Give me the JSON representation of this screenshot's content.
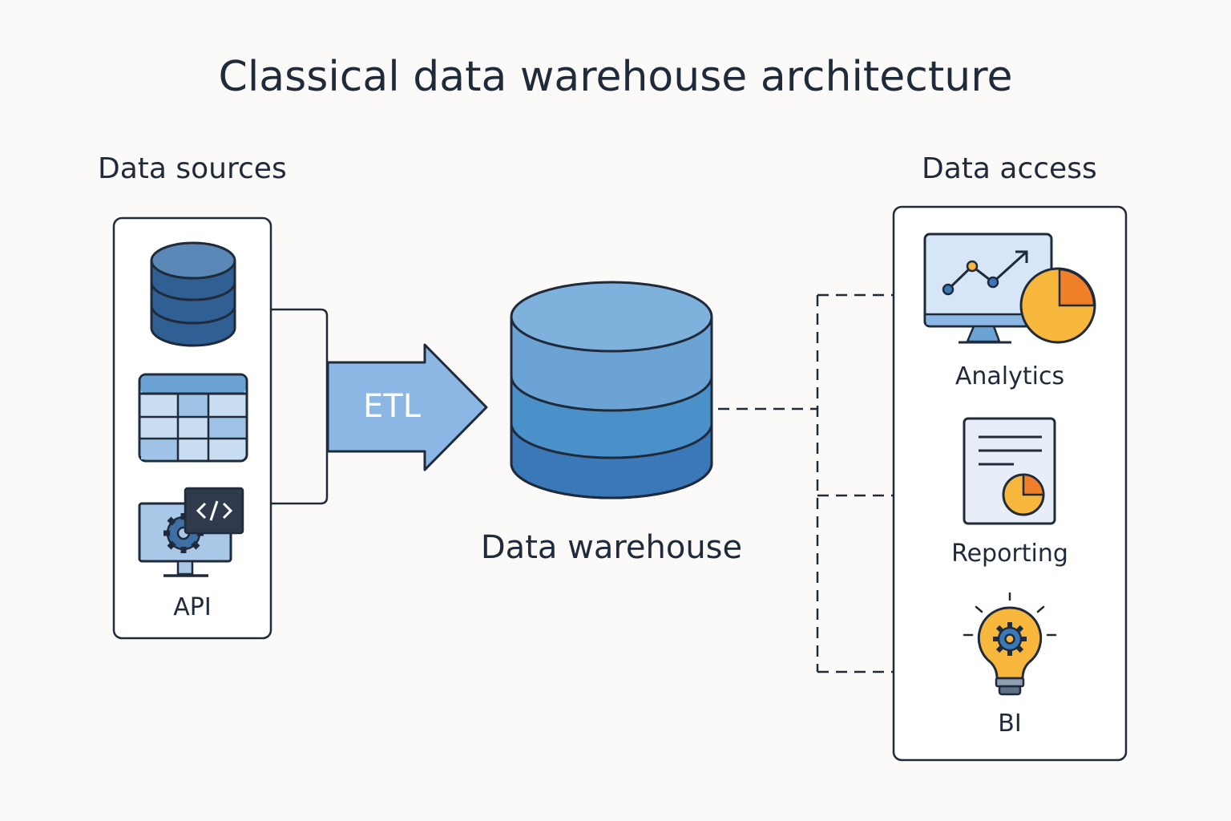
{
  "title": "Classical data warehouse architecture",
  "sources": {
    "heading": "Data sources",
    "items": [
      {
        "icon": "database-icon",
        "label": ""
      },
      {
        "icon": "table-icon",
        "label": ""
      },
      {
        "icon": "api-monitor-icon",
        "label": "API"
      }
    ]
  },
  "etl": {
    "label": "ETL"
  },
  "warehouse": {
    "label": "Data warehouse"
  },
  "access": {
    "heading": "Data access",
    "items": [
      {
        "icon": "analytics-icon",
        "label": "Analytics"
      },
      {
        "icon": "report-icon",
        "label": "Reporting"
      },
      {
        "icon": "lightbulb-gear-icon",
        "label": "BI"
      }
    ]
  },
  "colors": {
    "outline": "#1f2a3a",
    "db_dark": "#2f5f93",
    "warehouse_top": "#7fb1dd",
    "warehouse_mid1": "#6ba3d4",
    "warehouse_mid2": "#4a90c9",
    "warehouse_bottom": "#3b78b8",
    "etl_arrow": "#8cb6e3",
    "accent_yellow": "#f6b73c",
    "accent_orange": "#f07f2a"
  }
}
